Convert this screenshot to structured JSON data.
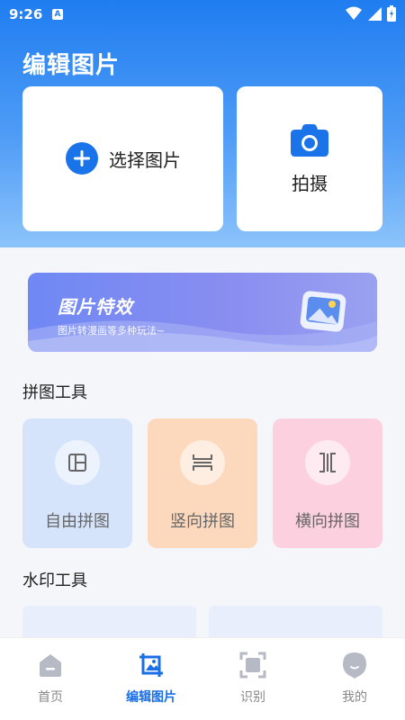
{
  "status_bar": {
    "time": "9:26",
    "notification_letter": "A"
  },
  "header": {
    "title": "编辑图片"
  },
  "actions": {
    "select_label": "选择图片",
    "camera_label": "拍摄"
  },
  "banner": {
    "title": "图片特效",
    "subtitle": "图片转漫画等多种玩法~"
  },
  "collage": {
    "section_title": "拼图工具",
    "tools": [
      {
        "label": "自由拼图",
        "icon": "layout-icon",
        "color": "#d6e4fb"
      },
      {
        "label": "竖向拼图",
        "icon": "vertical-split-icon",
        "color": "#fcd8bd"
      },
      {
        "label": "横向拼图",
        "icon": "horizontal-split-icon",
        "color": "#fcd0df"
      }
    ]
  },
  "watermark": {
    "section_title": "水印工具"
  },
  "nav": {
    "items": [
      {
        "label": "首页",
        "icon": "home-icon"
      },
      {
        "label": "编辑图片",
        "icon": "crop-image-icon"
      },
      {
        "label": "识别",
        "icon": "scan-icon"
      },
      {
        "label": "我的",
        "icon": "profile-icon"
      }
    ],
    "active_index": 1
  },
  "colors": {
    "primary": "#1a73e8",
    "nav_active": "#1a6fe6",
    "nav_inactive": "#888888"
  }
}
